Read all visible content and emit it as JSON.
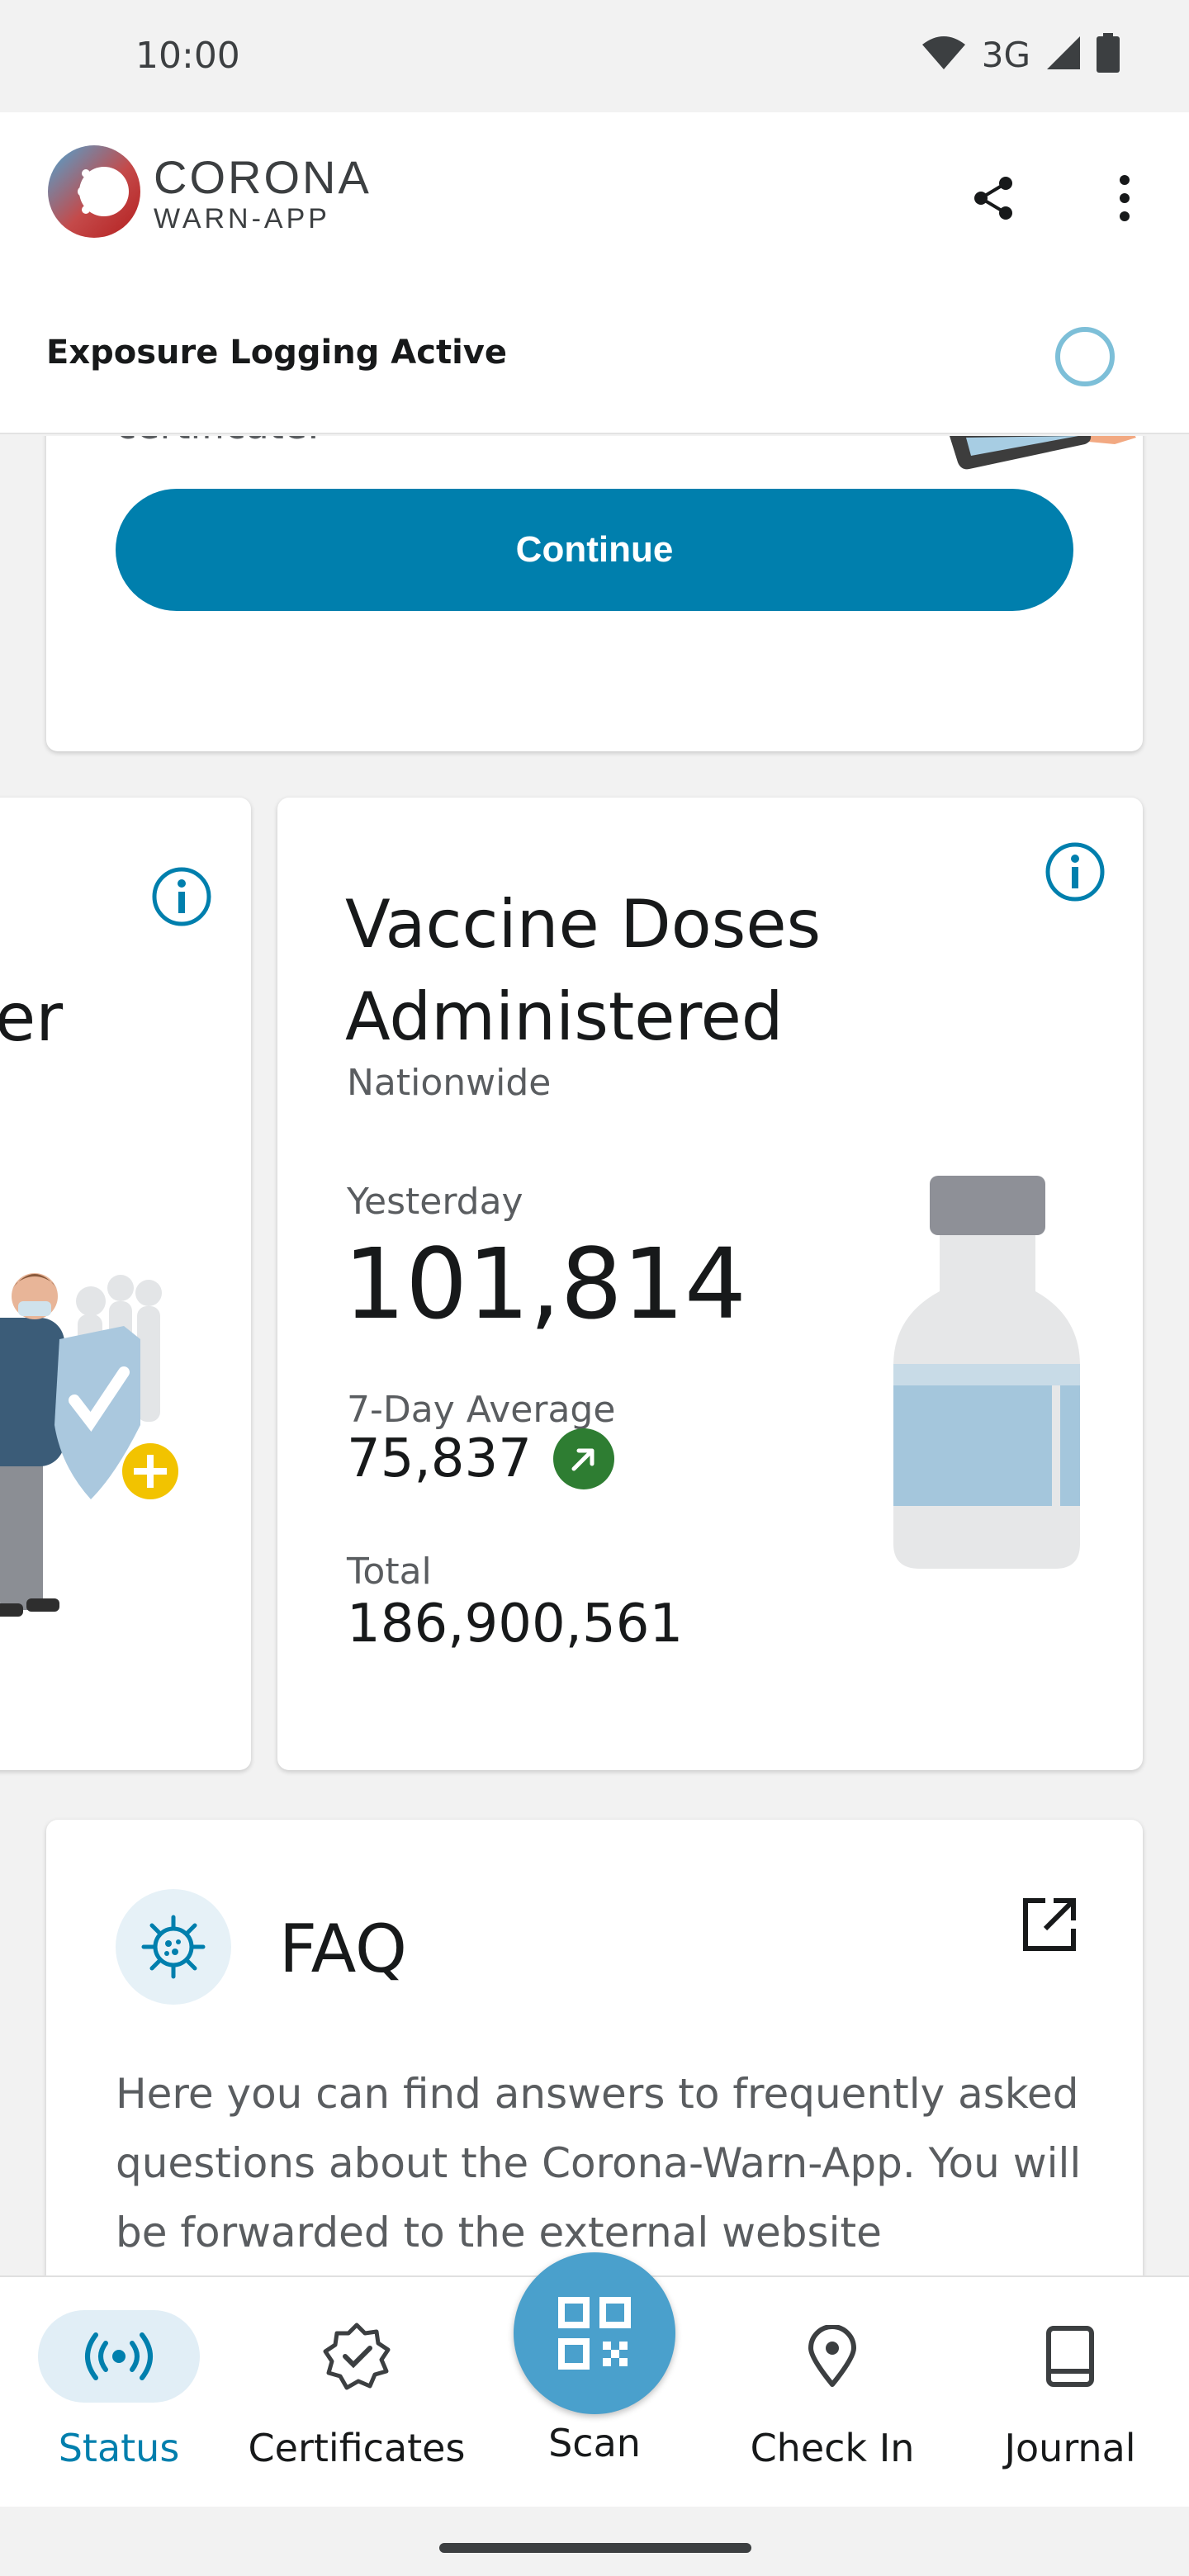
{
  "status_bar": {
    "time": "10:00",
    "network": "3G"
  },
  "header": {
    "logo_line1": "CORONA",
    "logo_line2": "WARN-APP",
    "exposure_title": "Exposure Logging Active",
    "icons": [
      "share-icon",
      "more-vert-icon"
    ]
  },
  "top_card": {
    "cut_text": "certificate.",
    "continue_label": "Continue"
  },
  "left_card": {
    "partial_text": "er"
  },
  "vaccine_card": {
    "title": "Vaccine Doses Administered",
    "subtitle": "Nationwide",
    "yesterday_label": "Yesterday",
    "yesterday_value": "101,814",
    "avg_label": "7-Day Average",
    "avg_value": "75,837",
    "trend": "up",
    "total_label": "Total",
    "total_value": "186,900,561"
  },
  "faq_card": {
    "title": "FAQ",
    "body": "Here you can find answers to frequently asked questions about the Corona-Warn-App. You will be forwarded to the external website"
  },
  "bottom_nav": {
    "status": "Status",
    "certificates": "Certificates",
    "scan": "Scan",
    "checkin": "Check In",
    "journal": "Journal"
  },
  "colors": {
    "accent": "#007fad",
    "scan": "#4aa0cc",
    "trend_up": "#2e7d32",
    "active_nav_bg": "#e1eef6"
  }
}
